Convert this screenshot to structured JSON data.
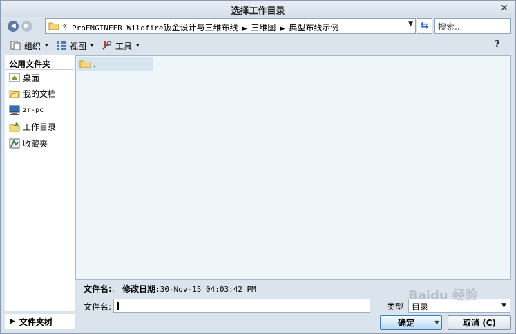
{
  "window": {
    "title": "选择工作目录",
    "close_glyph": "✕"
  },
  "nav": {
    "back_glyph": "◀",
    "forward_glyph": "▶"
  },
  "address": {
    "chevron": "«",
    "crumbs": [
      {
        "mono": "ProENGINEER Wildfire",
        "cjk": "钣金设计与三维布线"
      },
      {
        "label": "三维图"
      },
      {
        "label": "典型布线示例"
      }
    ],
    "separator": "▶",
    "dropdown_glyph": "▼",
    "refresh_glyph": "⇆"
  },
  "search": {
    "placeholder": "搜索..."
  },
  "toolbar": {
    "organize": "组织",
    "view": "视图",
    "tools": "工具",
    "arrow": "▾",
    "help_glyph": "?"
  },
  "sidebar": {
    "header": "公用文件夹",
    "items": [
      {
        "label": "桌面",
        "icon": "desktop-icon"
      },
      {
        "label": "我的文档",
        "icon": "documents-icon"
      },
      {
        "label": "zr-pc",
        "icon": "computer-icon"
      },
      {
        "label": "工作目录",
        "icon": "working-dir-icon"
      },
      {
        "label": "收藏夹",
        "icon": "favorites-icon"
      }
    ],
    "tree_label": "文件夹树",
    "tree_arrow": "▶"
  },
  "files": [
    {
      "name": ".",
      "icon": "folder-icon"
    }
  ],
  "details": {
    "name_label": "文件名:",
    "name_value": ".",
    "modified_label": "修改日期",
    "modified_value": ":30-Nov-15 04:03:42 PM"
  },
  "form": {
    "filename_label": "文件名:",
    "filename_value": "",
    "type_label": "类型",
    "type_value": "目录",
    "type_dropdown_glyph": "▼"
  },
  "buttons": {
    "ok": "确定",
    "ok_split_glyph": "▼",
    "cancel": "取消 (C)"
  },
  "watermark": "Baidu 经验",
  "colors": {
    "accent": "#2468c6",
    "list_bg": "#eef6fa",
    "selection": "#d5e4ee"
  }
}
